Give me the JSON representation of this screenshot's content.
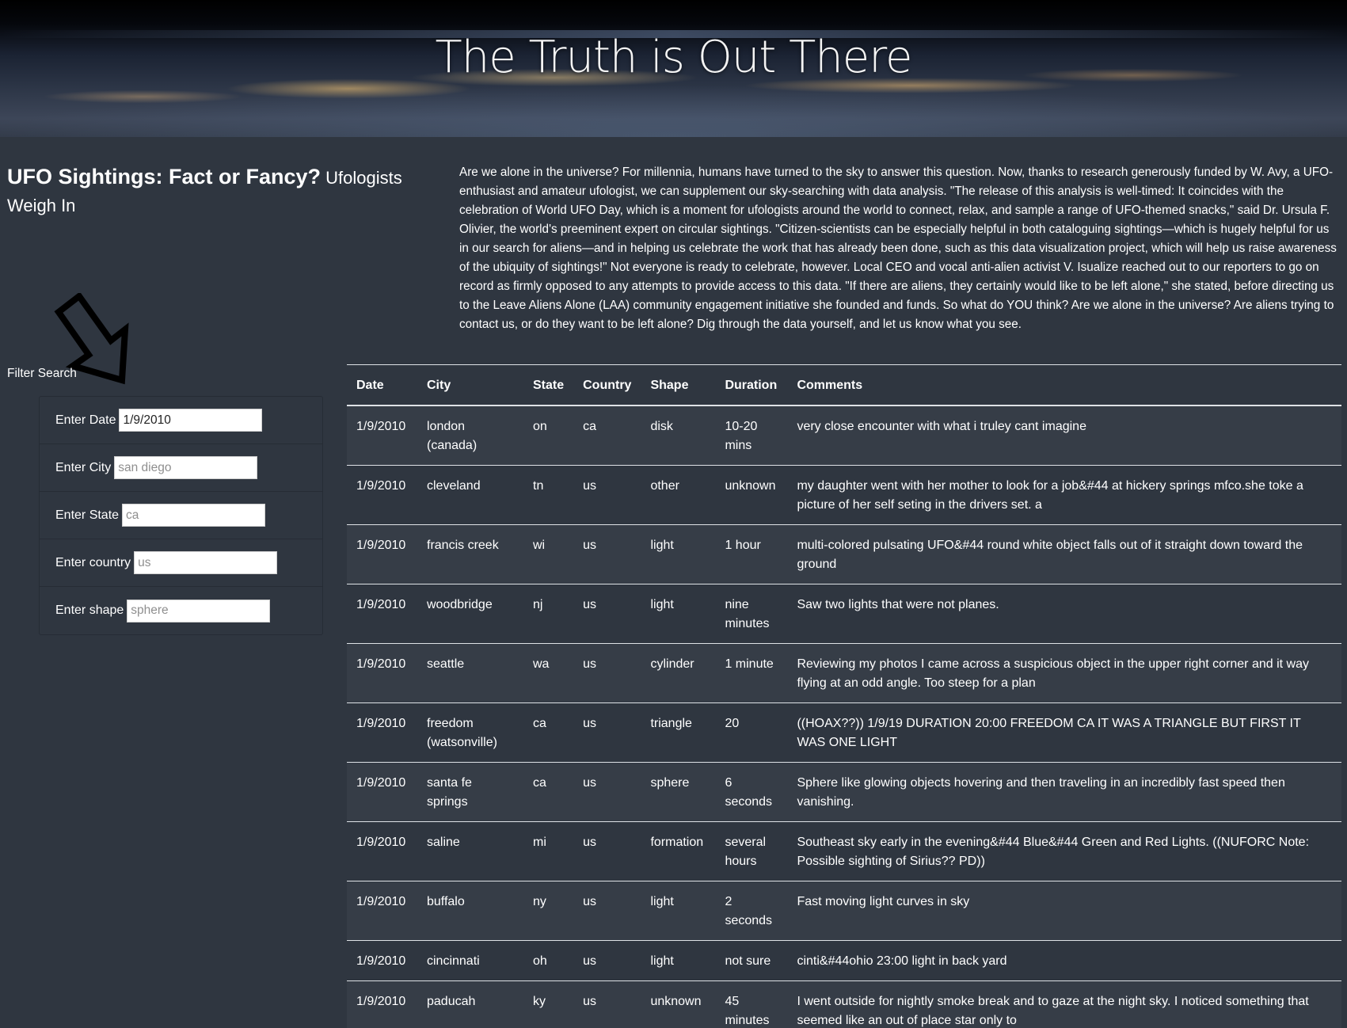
{
  "header": {
    "title": "The Truth is Out There"
  },
  "headline": {
    "main": "UFO Sightings: Fact or Fancy?",
    "sub": "Ufologists Weigh In"
  },
  "intro": "Are we alone in the universe? For millennia, humans have turned to the sky to answer this question. Now, thanks to research generously funded by W. Avy, a UFO-enthusiast and amateur ufologist, we can supplement our sky-searching with data analysis. \"The release of this analysis is well-timed: It coincides with the celebration of World UFO Day, which is a moment for ufologists around the world to connect, relax, and sample a range of UFO-themed snacks,\" said Dr. Ursula F. Olivier, the world's preeminent expert on circular sightings. \"Citizen-scientists can be especially helpful in both cataloguing sightings—which is hugely helpful for us in our search for aliens—and in helping us celebrate the work that has already been done, such as this data visualization project, which will help us raise awareness of the ubiquity of sightings!\" Not everyone is ready to celebrate, however. Local CEO and vocal anti-alien activist V. Isualize reached out to our reporters to go on record as firmly opposed to any attempts to provide access to this data. \"If there are aliens, they certainly would like to be left alone,\" she stated, before directing us to the Leave Aliens Alone (LAA) community engagement initiative she founded and funds. So what do YOU think? Are we alone in the universe? Are aliens trying to contact us, or do they want to be left alone? Dig through the data yourself, and let us know what you see.",
  "filter": {
    "title": "Filter Search",
    "date": {
      "label": "Enter Date",
      "value": "1/9/2010",
      "placeholder": ""
    },
    "city": {
      "label": "Enter City",
      "value": "",
      "placeholder": "san diego"
    },
    "state": {
      "label": "Enter State",
      "value": "",
      "placeholder": "ca"
    },
    "country": {
      "label": "Enter country",
      "value": "",
      "placeholder": "us"
    },
    "shape": {
      "label": "Enter shape",
      "value": "",
      "placeholder": "sphere"
    }
  },
  "table": {
    "headers": [
      "Date",
      "City",
      "State",
      "Country",
      "Shape",
      "Duration",
      "Comments"
    ],
    "rows": [
      [
        "1/9/2010",
        "london (canada)",
        "on",
        "ca",
        "disk",
        "10-20 mins",
        "very close encounter with what i truley cant imagine"
      ],
      [
        "1/9/2010",
        "cleveland",
        "tn",
        "us",
        "other",
        "unknown",
        "my daughter went with her mother to look for a job&#44 at hickery springs mfco.she toke a picture of her self seting in the drivers set. a"
      ],
      [
        "1/9/2010",
        "francis creek",
        "wi",
        "us",
        "light",
        "1 hour",
        "multi-colored pulsating UFO&#44 round white object falls out of it straight down toward the ground"
      ],
      [
        "1/9/2010",
        "woodbridge",
        "nj",
        "us",
        "light",
        "nine minutes",
        "Saw two lights that were not planes."
      ],
      [
        "1/9/2010",
        "seattle",
        "wa",
        "us",
        "cylinder",
        "1 minute",
        "Reviewing my photos I came across a suspicious object in the upper right corner and it way flying at an odd angle. Too steep for a plan"
      ],
      [
        "1/9/2010",
        "freedom (watsonville)",
        "ca",
        "us",
        "triangle",
        "20",
        "((HOAX??)) 1/9/19 DURATION 20:00 FREEDOM CA IT WAS A TRIANGLE BUT FIRST IT WAS ONE LIGHT"
      ],
      [
        "1/9/2010",
        "santa fe springs",
        "ca",
        "us",
        "sphere",
        "6 seconds",
        "Sphere like glowing objects hovering and then traveling in an incredibly fast speed then vanishing."
      ],
      [
        "1/9/2010",
        "saline",
        "mi",
        "us",
        "formation",
        "several hours",
        "Southeast sky early in the evening&#44 Blue&#44 Green and Red Lights. ((NUFORC Note: Possible sighting of Sirius?? PD))"
      ],
      [
        "1/9/2010",
        "buffalo",
        "ny",
        "us",
        "light",
        "2 seconds",
        "Fast moving light curves in sky"
      ],
      [
        "1/9/2010",
        "cincinnati",
        "oh",
        "us",
        "light",
        "not sure",
        "cinti&#44ohio 23:00 light in back yard"
      ],
      [
        "1/9/2010",
        "paducah",
        "ky",
        "us",
        "unknown",
        "45 minutes",
        "I went outside for nightly smoke break and to gaze at the night sky. I noticed something that seemed like an out of place star only to"
      ]
    ]
  }
}
